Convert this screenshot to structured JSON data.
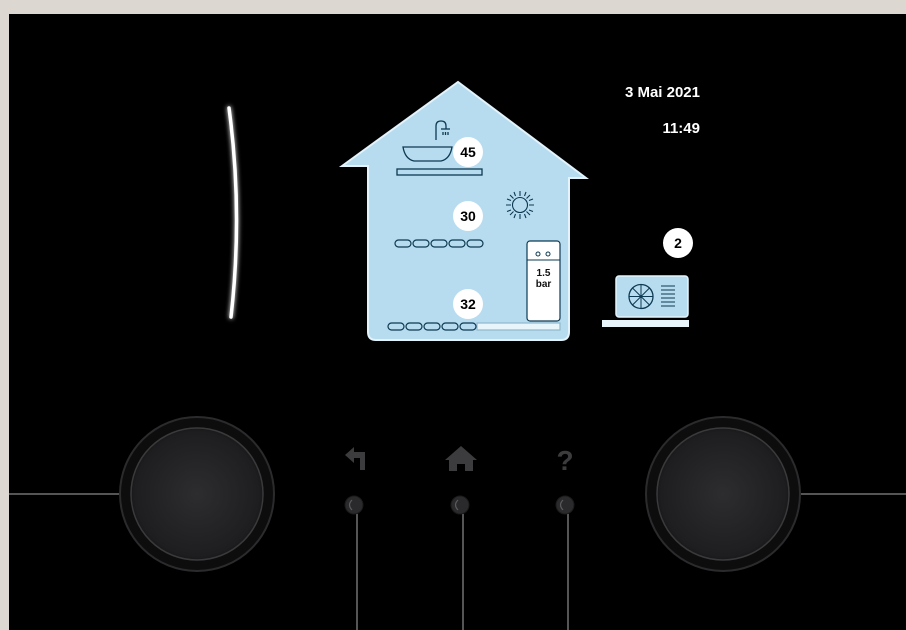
{
  "header": {
    "date": "3 Mai 2021",
    "time": "11:49"
  },
  "house": {
    "dhw_temp": "45",
    "room_temp": "30",
    "flow_temp": "32",
    "pressure_value": "1.5",
    "pressure_unit": "bar",
    "weather_icon": "sun-icon",
    "dhw_icon": "shower-washbasin-icon"
  },
  "heat_pump": {
    "badge": "2",
    "icon": "outdoor-unit-fan-icon"
  },
  "buttons": [
    {
      "name": "back",
      "icon": "back-arrow-icon"
    },
    {
      "name": "home",
      "icon": "home-icon"
    },
    {
      "name": "help",
      "icon": "question-icon",
      "glyph": "?"
    }
  ],
  "colors": {
    "house_fill": "#b8dcef",
    "house_stroke": "#dff2fb",
    "panel": "#000000",
    "background": "#dcd8d1"
  }
}
